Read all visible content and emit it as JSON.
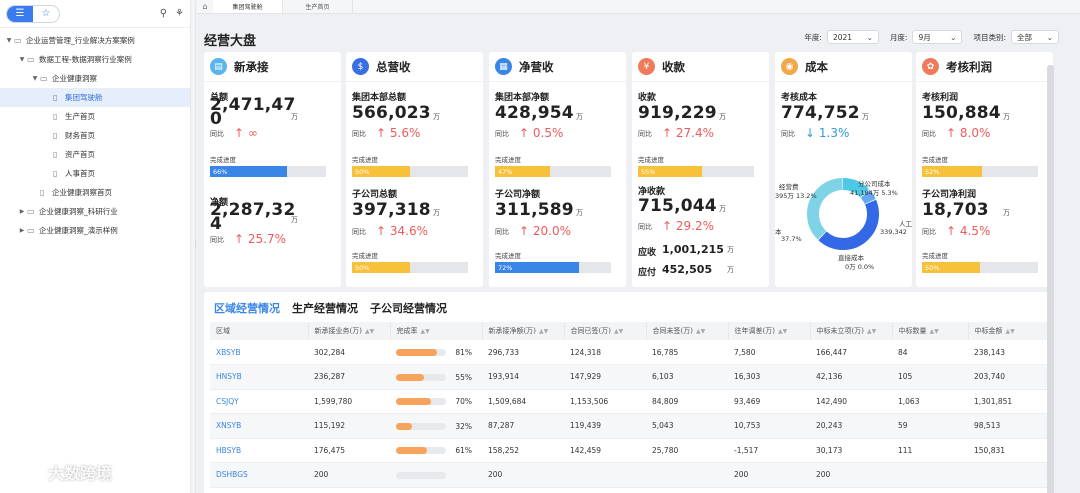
{
  "sidebar": {
    "tree": [
      {
        "label": "企业运营管理_行业解决方案案例",
        "level": 0,
        "arrow": "▼",
        "icon": "folder"
      },
      {
        "label": "数据工程-数据洞察行业案例",
        "level": 1,
        "arrow": "▼",
        "icon": "folder"
      },
      {
        "label": "企业健康洞察",
        "level": 2,
        "arrow": "▼",
        "icon": "folder"
      },
      {
        "label": "集团驾驶舱",
        "level": 3,
        "arrow": "",
        "icon": "doc",
        "selected": true
      },
      {
        "label": "生产首页",
        "level": 3,
        "arrow": "",
        "icon": "doc"
      },
      {
        "label": "财务首页",
        "level": 3,
        "arrow": "",
        "icon": "doc"
      },
      {
        "label": "资产首页",
        "level": 3,
        "arrow": "",
        "icon": "doc"
      },
      {
        "label": "人事首页",
        "level": 3,
        "arrow": "",
        "icon": "doc"
      },
      {
        "label": "企业健康洞察首页",
        "level": 2,
        "arrow": "",
        "icon": "doc"
      },
      {
        "label": "企业健康洞察_科研行业",
        "level": 1,
        "arrow": "▶",
        "icon": "folder"
      },
      {
        "label": "企业健康洞察_演示样例",
        "level": 1,
        "arrow": "▶",
        "icon": "folder"
      }
    ]
  },
  "tabs": [
    "集团驾驶舱",
    "生产首页"
  ],
  "page": {
    "title": "经营大盘"
  },
  "filters": {
    "year_label": "年度:",
    "year_value": "2021",
    "month_label": "月度:",
    "month_value": "9月",
    "category_label": "项目类别:",
    "category_value": "全部"
  },
  "cards": {
    "new": {
      "title": "新承接",
      "l1": "总额",
      "v1": "2,471,47",
      "v1b": "0",
      "unit": "万",
      "yoy_label": "同比",
      "yoy1": "↑ ∞",
      "prog_label": "完成进度",
      "p1_text": "66%",
      "p1": 0.66,
      "l2": "净额",
      "v2": "2,287,32",
      "v2b": "4",
      "yoy2": "↑ 25.7%"
    },
    "total": {
      "title": "总营收",
      "l1": "集团本部总额",
      "v1": "566,023",
      "unit": "万",
      "yoy_label": "同比",
      "yoy1": "↑ 5.6%",
      "prog_label": "完成进度",
      "p1_text": "50%",
      "p1": 0.5,
      "l2": "子公司总额",
      "v2": "397,318",
      "yoy2": "↑ 34.6%",
      "p2_text": "50%",
      "p2": 0.5
    },
    "net": {
      "title": "净营收",
      "l1": "集团本部净额",
      "v1": "428,954",
      "unit": "万",
      "yoy_label": "同比",
      "yoy1": "↑ 0.5%",
      "prog_label": "完成进度",
      "p1_text": "47%",
      "p1": 0.47,
      "l2": "子公司净额",
      "v2": "311,589",
      "yoy2": "↑ 20.0%",
      "p2_text": "72%",
      "p2": 0.72
    },
    "collect": {
      "title": "收款",
      "l1": "收款",
      "v1": "919,229",
      "unit": "万",
      "yoy_label": "同比",
      "yoy1": "↑ 27.4%",
      "prog_label": "完成进度",
      "p1_text": "55%",
      "p1": 0.55,
      "l2": "净收款",
      "v2": "715,044",
      "yoy2": "↑ 29.2%",
      "recv_label": "应收",
      "recv_value": "1,001,215",
      "pay_label": "应付",
      "pay_value": "452,505"
    },
    "cost": {
      "title": "成本",
      "l1": "考核成本",
      "v1": "774,752",
      "unit": "万",
      "yoy_label": "同比",
      "yoy1": "↓ 1.3%",
      "donut": [
        {
          "name": "经营费",
          "value_text": "395万",
          "pct_text": "13.2%",
          "pct": 13.2,
          "color": "#4dc9e6"
        },
        {
          "name": "分公司成本",
          "value_text": "41,184万",
          "pct_text": "5.3%",
          "pct": 5.3,
          "color": "#62a8f5"
        },
        {
          "name": "人工成本",
          "value_text": "339,342",
          "pct_text": "43.8%",
          "pct": 43.8,
          "color": "#3369e6"
        },
        {
          "name": "直接成本",
          "value_text": "0万",
          "pct_text": "0.0%",
          "pct": 0.0,
          "color": "#b8d8f5"
        },
        {
          "name": "材料成本",
          "value_text": "",
          "pct_text": "37.7%",
          "pct": 37.7,
          "color": "#7fd3e6"
        }
      ],
      "lbl_l1": "经营费",
      "lbl_l2": "395万  13.2%",
      "lbl_r1": "分公司成本",
      "lbl_r2": "41,184万  5.3%",
      "lbl_r3": "人工",
      "lbl_r4": "339,342",
      "lbl_b1": "直接成本",
      "lbl_b2": "0万  0.0%",
      "lbl_left1": "本",
      "lbl_left2": "37.7%"
    },
    "profit": {
      "title": "考核利润",
      "l1": "考核利润",
      "v1": "150,884",
      "unit": "万",
      "yoy_label": "同比",
      "yoy1": "↑ 8.0%",
      "prog_label": "完成进度",
      "p1_text": "52%",
      "p1": 0.52,
      "l2": "子公司净利润",
      "v2": "18,703",
      "yoy2": "↑ 4.5%",
      "p2_text": "50%",
      "p2": 0.5
    }
  },
  "section_tabs": [
    "区域经营情况",
    "生产经营情况",
    "子公司经营情况"
  ],
  "table": {
    "headers": [
      "区域",
      "新承接业务(万)",
      "完成率",
      "新承接净额(万)",
      "合同已签(万)",
      "合同未签(万)",
      "往年调差(万)",
      "中标未立项(万)",
      "中标数量",
      "中标金额"
    ],
    "rows": [
      {
        "c": [
          "XBSYB",
          "302,284",
          "81%",
          "296,733",
          "124,318",
          "16,785",
          "7,580",
          "166,447",
          "84",
          "238,143"
        ],
        "rate": 0.81
      },
      {
        "c": [
          "HNSYB",
          "236,287",
          "55%",
          "193,914",
          "147,929",
          "6,103",
          "16,303",
          "42,136",
          "105",
          "203,740"
        ],
        "rate": 0.55
      },
      {
        "c": [
          "CSJQY",
          "1,599,780",
          "70%",
          "1,509,684",
          "1,153,506",
          "84,809",
          "93,469",
          "142,490",
          "1,063",
          "1,301,851"
        ],
        "rate": 0.7
      },
      {
        "c": [
          "XNSYB",
          "115,192",
          "32%",
          "87,287",
          "119,439",
          "5,043",
          "10,753",
          "20,243",
          "59",
          "98,513"
        ],
        "rate": 0.32
      },
      {
        "c": [
          "HBSYB",
          "176,475",
          "61%",
          "158,252",
          "142,459",
          "25,780",
          "-1,517",
          "30,173",
          "111",
          "150,831"
        ],
        "rate": 0.61
      },
      {
        "c": [
          "DSHBGS",
          "200",
          "",
          "200",
          "",
          "",
          "200",
          "200",
          "",
          ""
        ],
        "rate": 0
      }
    ]
  },
  "watermark": {
    "logo": "(o_o)",
    "text": "大数跨境"
  }
}
